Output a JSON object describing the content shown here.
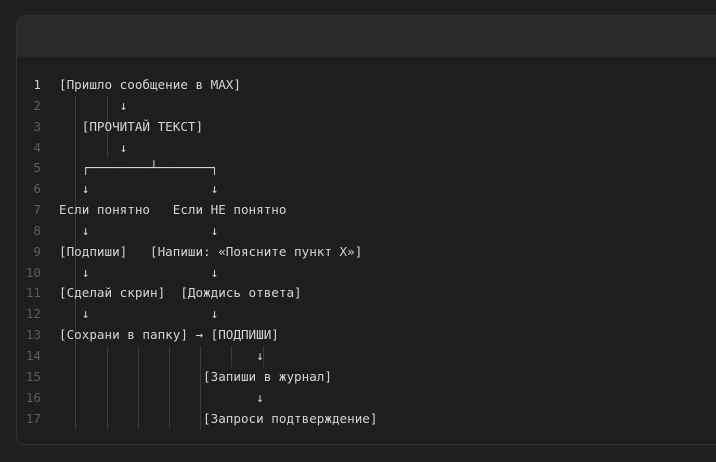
{
  "editor": {
    "active_line": 1,
    "lines": [
      {
        "n": "1",
        "text": "[Пришло сообщение в MAX]"
      },
      {
        "n": "2",
        "text": "        ↓"
      },
      {
        "n": "3",
        "text": "   [ПРОЧИТАЙ ТЕКСТ]"
      },
      {
        "n": "4",
        "text": "        ↓"
      },
      {
        "n": "5",
        "text": "   ┌────────┴───────┐"
      },
      {
        "n": "6",
        "text": "   ↓                ↓"
      },
      {
        "n": "7",
        "text": "Если понятно   Если НЕ понятно"
      },
      {
        "n": "8",
        "text": "   ↓                ↓"
      },
      {
        "n": "9",
        "text": "[Подпиши]   [Напиши: «Поясните пункт X»]"
      },
      {
        "n": "10",
        "text": "   ↓                ↓"
      },
      {
        "n": "11",
        "text": "[Сделай скрин]  [Дождись ответа]"
      },
      {
        "n": "12",
        "text": "   ↓                ↓"
      },
      {
        "n": "13",
        "text": "[Сохрани в папку] → [ПОДПИШИ]"
      },
      {
        "n": "14",
        "text": "                          ↓"
      },
      {
        "n": "15",
        "text": "                   [Запиши в журнал]"
      },
      {
        "n": "16",
        "text": "                          ↓"
      },
      {
        "n": "17",
        "text": "                   [Запроси подтверждение]"
      }
    ]
  }
}
